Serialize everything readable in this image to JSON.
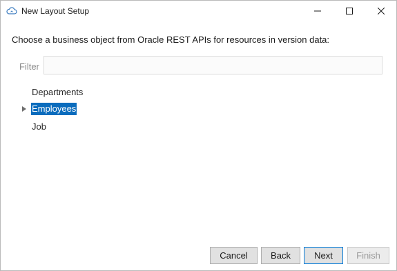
{
  "window": {
    "title": "New Layout Setup",
    "icon": "cloud-sync-icon",
    "controls": {
      "minimize": "minimize-icon",
      "maximize": "maximize-icon",
      "close": "close-icon"
    }
  },
  "main": {
    "prompt": "Choose a business object from Oracle REST APIs for resources in version data:",
    "filter": {
      "label": "Filter",
      "value": "",
      "placeholder": ""
    },
    "tree": {
      "items": [
        {
          "label": "Departments",
          "expandable": false,
          "selected": false
        },
        {
          "label": "Employees",
          "expandable": true,
          "selected": true
        },
        {
          "label": "Job",
          "expandable": false,
          "selected": false
        }
      ]
    }
  },
  "footer": {
    "cancel_label": "Cancel",
    "back_label": "Back",
    "next_label": "Next",
    "finish_label": "Finish"
  },
  "colors": {
    "selection": "#0b6cbd",
    "default_button_border": "#0078d7",
    "button_bg": "#e1e1e1",
    "disabled_text": "#9b9b9b"
  }
}
